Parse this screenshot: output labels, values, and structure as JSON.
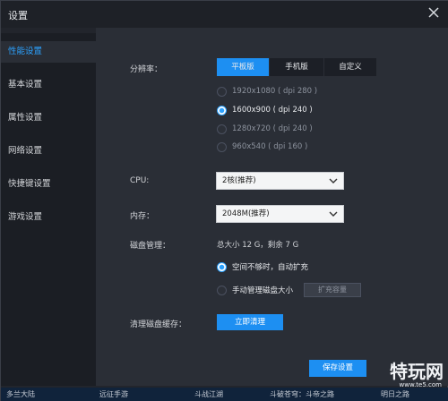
{
  "window": {
    "title": "设置"
  },
  "sidebar": {
    "items": [
      {
        "label": "性能设置"
      },
      {
        "label": "基本设置"
      },
      {
        "label": "属性设置"
      },
      {
        "label": "网络设置"
      },
      {
        "label": "快捷键设置"
      },
      {
        "label": "游戏设置"
      }
    ]
  },
  "resolution": {
    "label": "分辨率：",
    "tabs": [
      "平板版",
      "手机版",
      "自定义"
    ],
    "options": [
      "1920x1080 ( dpi 280 )",
      "1600x900 ( dpi 240 )",
      "1280x720 ( dpi 240 )",
      "960x540 ( dpi 160 )"
    ]
  },
  "cpu": {
    "label": "CPU:",
    "value": "2核(推荐)"
  },
  "memory": {
    "label": "内存：",
    "value": "2048M(推荐)"
  },
  "disk": {
    "label": "磁盘管理：",
    "info": "总大小 12 G，剩余 7 G",
    "opt_auto": "空间不够时，自动扩充",
    "opt_manual": "手动管理磁盘大小",
    "expand_button": "扩充容量"
  },
  "cache": {
    "label": "清理磁盘缓存：",
    "button": "立即清理"
  },
  "save_button": "保存设置",
  "bottom_bar": [
    "多兰大陆",
    "远征手游",
    "斗战江湖",
    "斗破苍穹：斗帝之路",
    "明日之路"
  ],
  "watermark": {
    "text": "特玩网",
    "url": "www.te5.com"
  },
  "colors": {
    "accent": "#1d8ff2",
    "panel": "#2a2e36",
    "sidebar": "#1b1e24"
  }
}
